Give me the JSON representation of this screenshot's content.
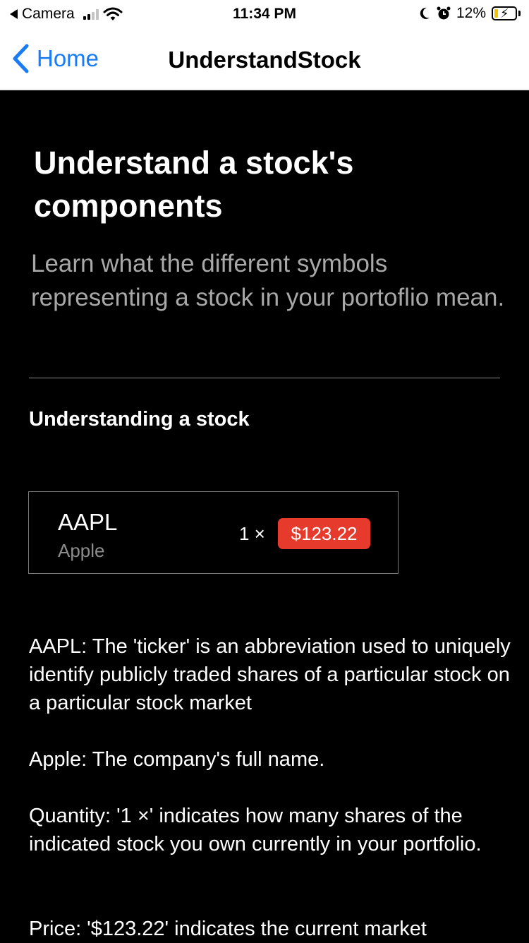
{
  "status_bar": {
    "back_app": "Camera",
    "time": "11:34 PM",
    "battery": "12%"
  },
  "nav": {
    "back_label": "Home",
    "title": "UnderstandStock"
  },
  "page": {
    "title": "Understand a stock's components",
    "subtitle": "Learn what the different symbols representing a stock in your portoflio mean.",
    "section_title": "Understanding a stock"
  },
  "stock_card": {
    "ticker": "AAPL",
    "company": "Apple",
    "quantity": "1 ×",
    "price": "$123.22"
  },
  "explanations": [
    "AAPL: The 'ticker' is an abbreviation used to uniquely identify publicly traded shares of a particular stock on a particular stock market",
    "Apple: The company's full name.",
    "Quantity: '1 ×' indicates how many shares of the indicated stock you own currently in your portfolio.",
    "Price: '$123.22' indicates the current market"
  ],
  "colors": {
    "accent": "#1a7cf5",
    "price_badge": "#e53a2c",
    "background": "#000000"
  },
  "icons": [
    "back-triangle-icon",
    "signal-icon",
    "wifi-icon",
    "moon-icon",
    "alarm-icon",
    "battery-icon",
    "chevron-left-icon"
  ]
}
